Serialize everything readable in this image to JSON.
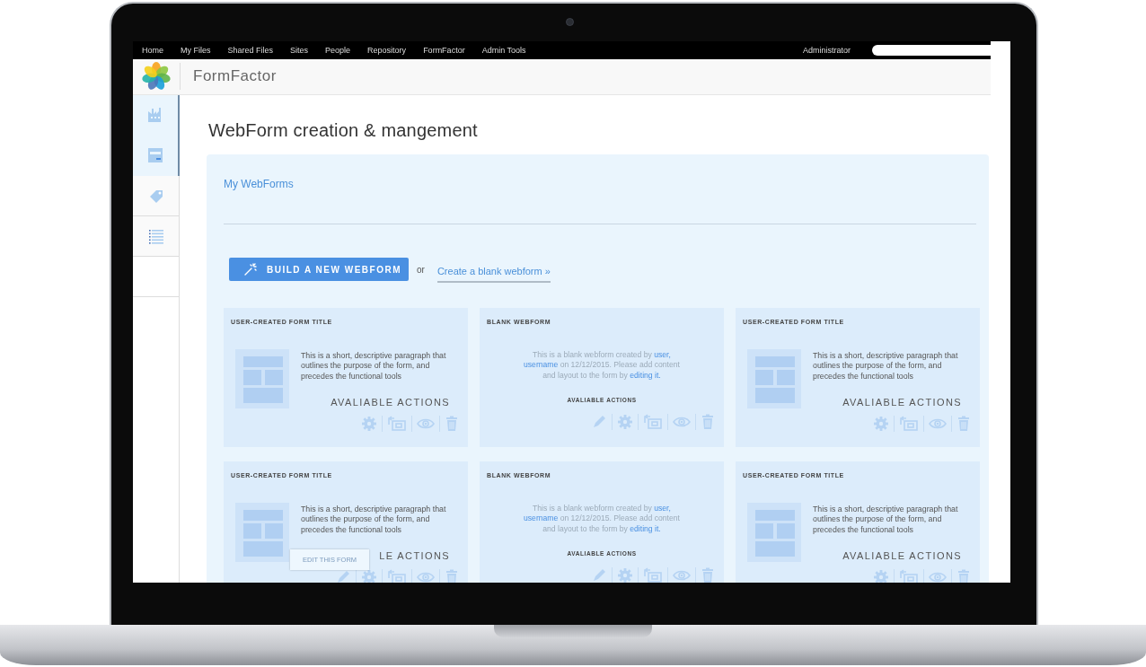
{
  "nav": {
    "items": [
      "Home",
      "My Files",
      "Shared Files",
      "Sites",
      "People",
      "Repository",
      "FormFactor",
      "Admin Tools"
    ],
    "user": "Administrator"
  },
  "header": {
    "title": "FormFactor"
  },
  "sidebar": {
    "items": [
      {
        "kind": "factory",
        "selected": true
      },
      {
        "kind": "form",
        "selected": true
      },
      {
        "kind": "tag",
        "selected": false
      },
      {
        "kind": "list",
        "selected": false
      }
    ]
  },
  "page_title": "WebForm creation & mangement",
  "panel": {
    "heading": "My WebForms",
    "build_button": "BUILD A NEW WEBFORM",
    "or": "or",
    "blank_link": "Create a blank webform »"
  },
  "cards": [
    {
      "kind": "user",
      "title": "USER-CREATED FORM TITLE",
      "text": "This is a short, descriptive paragraph that outlines the purpose of the form, and precedes the functional tools",
      "actions_label": "AVALIABLE ACTIONS",
      "actions": [
        {
          "kind": "settings"
        },
        {
          "kind": "move"
        },
        {
          "kind": "view"
        },
        {
          "kind": "delete"
        }
      ]
    },
    {
      "kind": "blank",
      "title": "BLANK WEBFORM",
      "parts": [
        {
          "kind": "text",
          "text": "This is a blank webform created by"
        },
        {
          "kind": "link",
          "text": "user,"
        },
        {
          "kind": "link",
          "text": "username"
        },
        {
          "kind": "text",
          "text": "on 12/12/2015. Please add content and layout to the form by"
        },
        {
          "kind": "link",
          "text": "editing it."
        }
      ],
      "actions_label": "AVALIABLE ACTIONS",
      "actions": [
        {
          "kind": "edit"
        },
        {
          "kind": "settings"
        },
        {
          "kind": "move"
        },
        {
          "kind": "view"
        },
        {
          "kind": "delete"
        }
      ]
    },
    {
      "kind": "user",
      "title": "USER-CREATED FORM TITLE",
      "text": "This is a short, descriptive paragraph that outlines the purpose of the form, and precedes the functional tools",
      "actions_label": "AVALIABLE ACTIONS",
      "actions": [
        {
          "kind": "settings"
        },
        {
          "kind": "move"
        },
        {
          "kind": "view"
        },
        {
          "kind": "delete"
        }
      ]
    },
    {
      "kind": "user",
      "title": "USER-CREATED FORM TITLE",
      "text": "This is a short, descriptive paragraph that outlines the purpose of the form, and precedes the functional tools",
      "actions_label": "LE ACTIONS",
      "actions": [
        {
          "kind": "edit"
        },
        {
          "kind": "settings"
        },
        {
          "kind": "move"
        },
        {
          "kind": "view"
        },
        {
          "kind": "delete"
        }
      ],
      "tooltip": "EDIT THIS FORM"
    },
    {
      "kind": "blank",
      "title": "BLANK WEBFORM",
      "parts": [
        {
          "kind": "text",
          "text": "This is a blank webform created by"
        },
        {
          "kind": "link",
          "text": "user,"
        },
        {
          "kind": "link",
          "text": "username"
        },
        {
          "kind": "text",
          "text": "on 12/12/2015. Please add content and layout to the form by"
        },
        {
          "kind": "link",
          "text": "editing it."
        }
      ],
      "actions_label": "AVALIABLE ACTIONS",
      "actions": [
        {
          "kind": "edit"
        },
        {
          "kind": "settings"
        },
        {
          "kind": "move"
        },
        {
          "kind": "view"
        },
        {
          "kind": "delete"
        }
      ]
    },
    {
      "kind": "user",
      "title": "USER-CREATED FORM TITLE",
      "text": "This is a short, descriptive paragraph that outlines the purpose of the form, and precedes the functional tools",
      "actions_label": "AVALIABLE ACTIONS",
      "actions": [
        {
          "kind": "settings"
        },
        {
          "kind": "move"
        },
        {
          "kind": "view"
        },
        {
          "kind": "delete"
        }
      ]
    }
  ]
}
